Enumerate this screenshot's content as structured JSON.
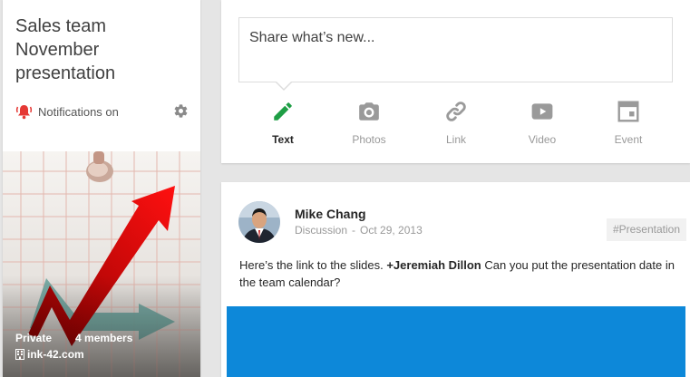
{
  "community": {
    "title": "Sales team November presentation",
    "notifications_label": "Notifications on",
    "visibility": "Private",
    "members": "4 members",
    "domain": "ink-42.com"
  },
  "share": {
    "placeholder": "Share what’s new...",
    "tabs": [
      {
        "label": "Text",
        "icon": "pencil-icon",
        "active": true
      },
      {
        "label": "Photos",
        "icon": "camera-icon",
        "active": false
      },
      {
        "label": "Link",
        "icon": "link-icon",
        "active": false
      },
      {
        "label": "Video",
        "icon": "video-icon",
        "active": false
      },
      {
        "label": "Event",
        "icon": "calendar-icon",
        "active": false
      }
    ]
  },
  "post": {
    "author": "Mike Chang",
    "category": "Discussion",
    "separator": "-",
    "date": "Oct 29, 2013",
    "tag": "#Presentation",
    "body_before": "Here’s the link to the slides. ",
    "mention": "+Jeremiah Dillon",
    "body_after": "  Can you put the presentation date in the team calendar?"
  },
  "colors": {
    "accent_green": "#1e9e45",
    "bell_red": "#e53935",
    "attachment_blue": "#0d88d9"
  }
}
